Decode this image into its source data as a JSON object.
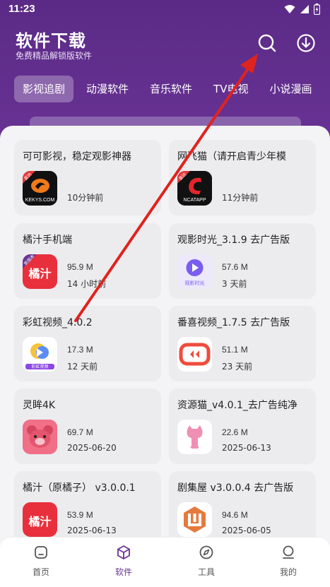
{
  "status": {
    "time": "11:23"
  },
  "header": {
    "title": "软件下载",
    "subtitle": "免费精品解锁版软件",
    "search_icon": "search-icon",
    "download_icon": "download-icon"
  },
  "tabs": [
    {
      "label": "影视追剧"
    },
    {
      "label": "动漫软件"
    },
    {
      "label": "音乐软件"
    },
    {
      "label": "TV电视"
    },
    {
      "label": "小说漫画"
    }
  ],
  "apps": [
    {
      "title": "可可影视，稳定观影神器",
      "line1": "",
      "line2": "10分钟前",
      "icon_text": "KEKYS.COM",
      "badge": "直达"
    },
    {
      "title": "网飞猫（请开启青少年模",
      "line1": "",
      "line2": "11分钟前",
      "icon_text": "NCATAPP",
      "badge": "直达"
    },
    {
      "title": "橘汁手机端",
      "line1": "95.9 M",
      "line2": "14 小时前",
      "icon_text": "橘汁",
      "badge": "新版本"
    },
    {
      "title": "观影时光_3.1.9 去广告版",
      "line1": "57.6 M",
      "line2": "3 天前",
      "icon_text": "观影时光",
      "badge": ""
    },
    {
      "title": "彩虹视频_4.0.2",
      "line1": "17.3 M",
      "line2": "12 天前",
      "icon_text": "彩虹视频",
      "badge": ""
    },
    {
      "title": "番喜视频_1.7.5 去广告版",
      "line1": "51.1 M",
      "line2": "23 天前",
      "icon_text": "",
      "badge": ""
    },
    {
      "title": "灵眸4K",
      "line1": "69.7 M",
      "line2": "2025-06-20",
      "icon_text": "",
      "badge": ""
    },
    {
      "title": "资源猫_v4.0.1_去广告纯净",
      "line1": "22.6 M",
      "line2": "2025-06-13",
      "icon_text": "",
      "badge": ""
    },
    {
      "title": "橘汁（原橘子） v3.0.0.1",
      "line1": "53.9 M",
      "line2": "2025-06-13",
      "icon_text": "橘汁",
      "badge": ""
    },
    {
      "title": "剧集屋 v3.0.0.4 去广告版",
      "line1": "94.6 M",
      "line2": "2025-06-05",
      "icon_text": "",
      "badge": ""
    }
  ],
  "bottom_nav": [
    {
      "label": "首页",
      "icon": "home-icon"
    },
    {
      "label": "软件",
      "icon": "box-icon"
    },
    {
      "label": "工具",
      "icon": "compass-icon"
    },
    {
      "label": "我的",
      "icon": "person-icon"
    }
  ],
  "colors": {
    "header": "#5b2a86",
    "accent": "#6a3496",
    "card": "#ececef",
    "arrow": "#e0231e"
  }
}
